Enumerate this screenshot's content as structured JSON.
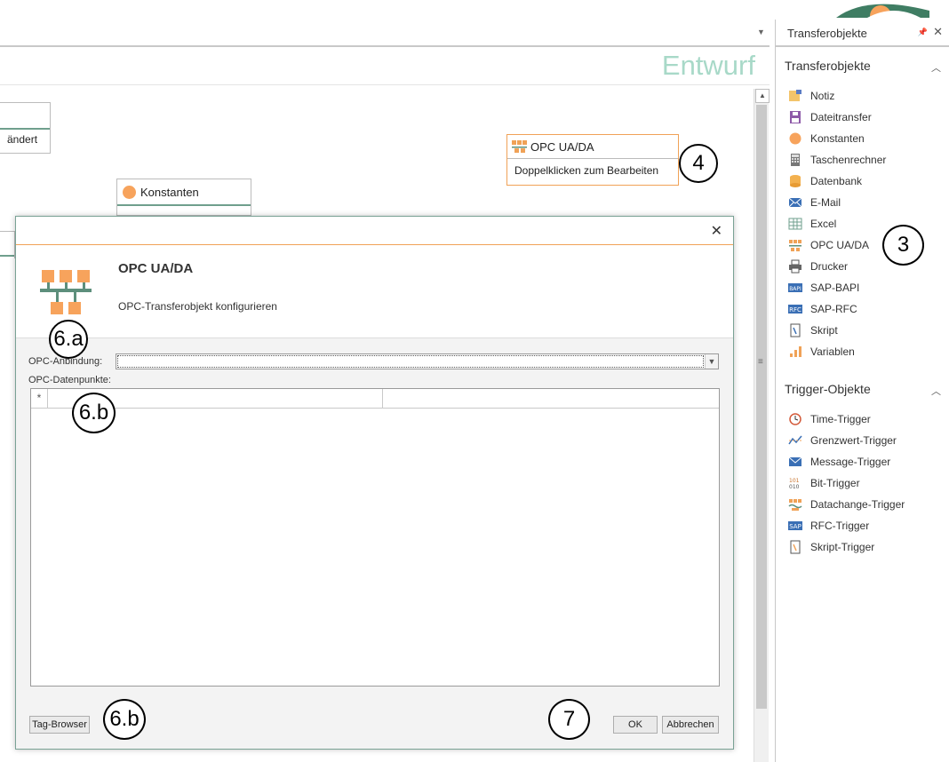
{
  "canvas": {
    "draft_label": "Entwurf",
    "partial_node_text": "ändert",
    "konstanten_node": {
      "title": "Konstanten"
    },
    "opc_node": {
      "title": "OPC UA/DA",
      "hint": "Doppelklicken zum Bearbeiten"
    }
  },
  "annotations": {
    "a4": "4",
    "a3": "3",
    "a6a": "6.a",
    "a6b_grid": "6.b",
    "a6b_button": "6.b",
    "a7": "7"
  },
  "dialog": {
    "close_glyph": "✕",
    "title": "OPC UA/DA",
    "subtitle": "OPC-Transferobjekt konfigurieren",
    "connection_label": "OPC-Anbindung:",
    "connection_value": "",
    "datapoints_label": "OPC-Datenpunkte:",
    "new_row_marker": "*",
    "buttons": {
      "tag_browser": "Tag-Browser",
      "ok": "OK",
      "cancel": "Abbrechen"
    }
  },
  "panel": {
    "tab_title": "Transferobjekte",
    "sections": [
      {
        "title": "Transferobjekte",
        "items": [
          {
            "label": "Notiz",
            "icon": "note-icon"
          },
          {
            "label": "Dateitransfer",
            "icon": "file-transfer-icon"
          },
          {
            "label": "Konstanten",
            "icon": "constant-icon"
          },
          {
            "label": "Taschenrechner",
            "icon": "calculator-icon"
          },
          {
            "label": "Datenbank",
            "icon": "database-icon"
          },
          {
            "label": "E-Mail",
            "icon": "email-icon"
          },
          {
            "label": "Excel",
            "icon": "excel-icon"
          },
          {
            "label": "OPC UA/DA",
            "icon": "opc-icon"
          },
          {
            "label": "Drucker",
            "icon": "printer-icon"
          },
          {
            "label": "SAP-BAPI",
            "icon": "sap-bapi-icon"
          },
          {
            "label": "SAP-RFC",
            "icon": "sap-rfc-icon"
          },
          {
            "label": "Skript",
            "icon": "script-icon"
          },
          {
            "label": "Variablen",
            "icon": "variables-icon"
          }
        ]
      },
      {
        "title": "Trigger-Objekte",
        "items": [
          {
            "label": "Time-Trigger",
            "icon": "time-trigger-icon"
          },
          {
            "label": "Grenzwert-Trigger",
            "icon": "threshold-trigger-icon"
          },
          {
            "label": "Message-Trigger",
            "icon": "message-trigger-icon"
          },
          {
            "label": "Bit-Trigger",
            "icon": "bit-trigger-icon"
          },
          {
            "label": "Datachange-Trigger",
            "icon": "datachange-trigger-icon"
          },
          {
            "label": "RFC-Trigger",
            "icon": "rfc-trigger-icon"
          },
          {
            "label": "Skript-Trigger",
            "icon": "script-trigger-icon"
          }
        ]
      }
    ]
  },
  "colors": {
    "accent_orange": "#f0a257",
    "accent_green": "#6f9f8d",
    "draft_text": "#a8d9c8"
  }
}
